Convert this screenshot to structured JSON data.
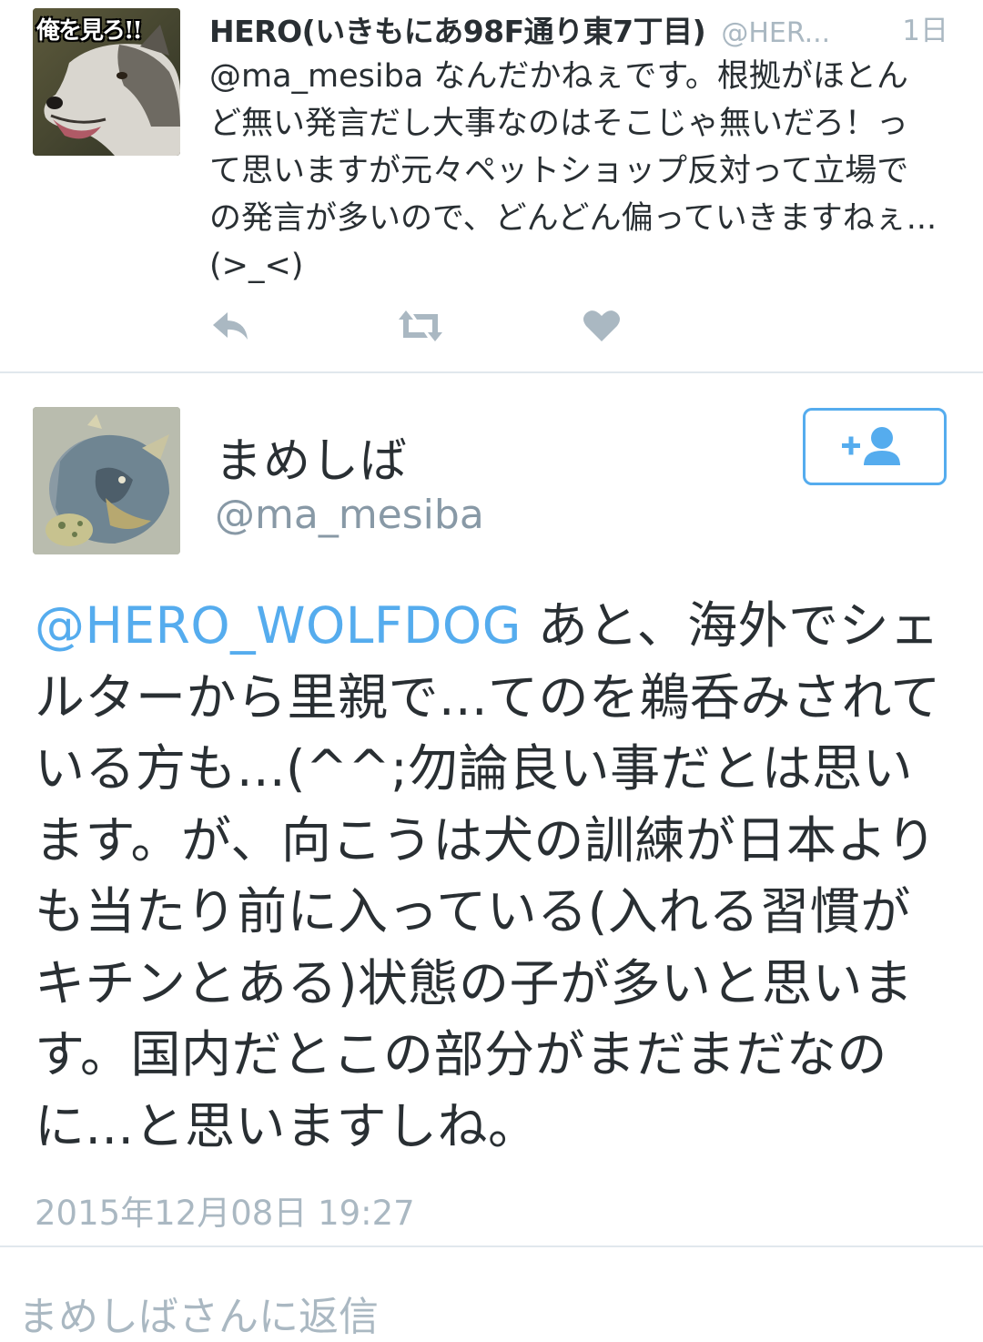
{
  "reply_tweet": {
    "name": "HERO(いきもにあ98F通り東7丁目)",
    "handle": "@HER...",
    "time": "1日",
    "avatar_text": "俺を見ろ!!",
    "mention": "@ma_mesiba",
    "text": " なんだかねぇです。根拠がほとんど無い発言だし大事なのはそこじゃ無いだろ！って思いますが元々ペットショップ反対って立場での発言が多いので、どんどん偏っていきますねぇ...(>_<)"
  },
  "actions": {
    "reply_icon": "reply-arrow-icon",
    "retweet_icon": "retweet-icon",
    "like_icon": "heart-icon"
  },
  "main_tweet": {
    "name": "まめしば",
    "handle": "@ma_mesiba",
    "follow_icon": "add-user-icon",
    "mention": "@HERO_WOLFDOG",
    "text": " あと、海外でシェルターから里親で...てのを鵜呑みされている方も...(^^;勿論良い事だとは思います。が、向こうは犬の訓練が日本よりも当たり前に入っている(入れる習慣がキチンとある)状態の子が多いと思います。国内だとこの部分がまだまだなのに...と思いますしね。",
    "timestamp": "2015年12月08日 19:27"
  },
  "compose": {
    "placeholder": "まめしばさんに返信"
  },
  "colors": {
    "link": "#55acee",
    "muted": "#aab8c2",
    "text": "#292f33",
    "divider": "#e1e8ed"
  }
}
